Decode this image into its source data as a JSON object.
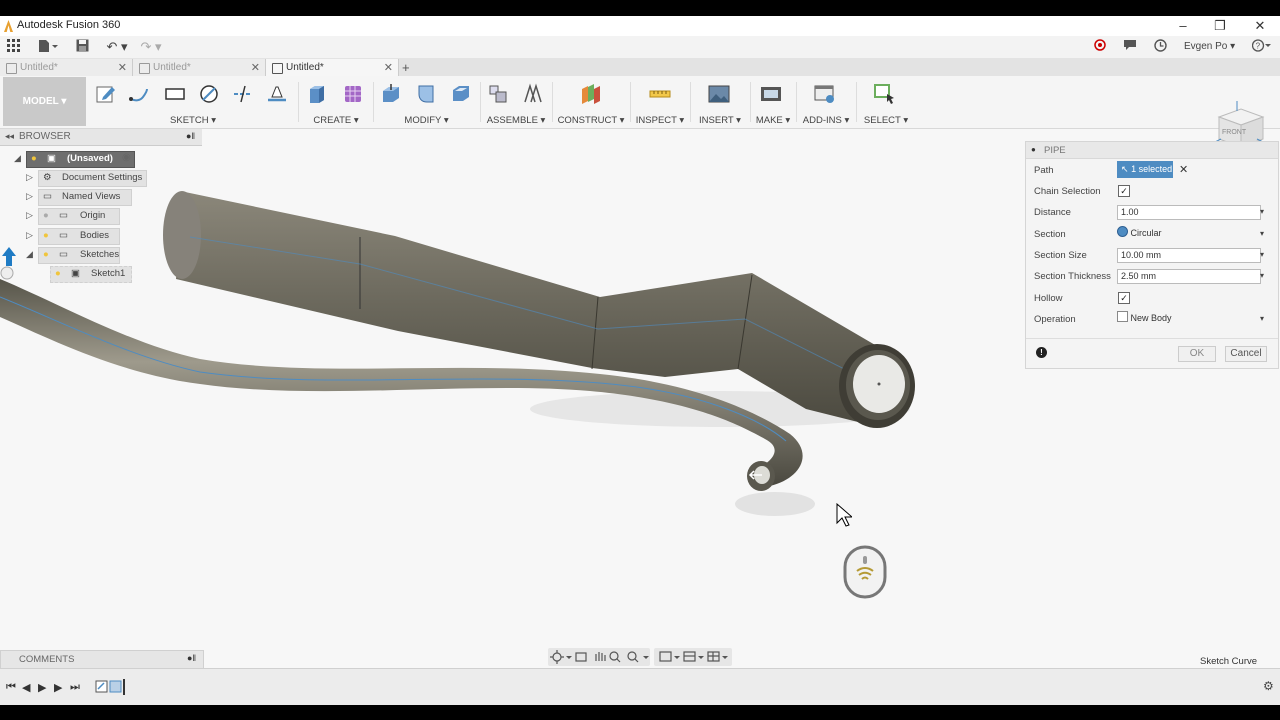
{
  "window": {
    "title": "Autodesk Fusion 360"
  },
  "appbar": {
    "user": "Evgen Po ▾"
  },
  "tabs": [
    {
      "label": "Untitled*",
      "active": false
    },
    {
      "label": "Untitled*",
      "active": false
    },
    {
      "label": "Untitled*",
      "active": true
    }
  ],
  "toolbar": {
    "workspace": "MODEL ▾",
    "groups": {
      "sketch": "SKETCH ▾",
      "create": "CREATE ▾",
      "modify": "MODIFY ▾",
      "assemble": "ASSEMBLE ▾",
      "construct": "CONSTRUCT ▾",
      "inspect": "INSPECT ▾",
      "insert": "INSERT ▾",
      "make": "MAKE ▾",
      "addins": "ADD-INS ▾",
      "select": "SELECT ▾"
    }
  },
  "browser": {
    "title": "BROWSER",
    "items": [
      {
        "label": "(Unsaved)"
      },
      {
        "label": "Document Settings"
      },
      {
        "label": "Named Views"
      },
      {
        "label": "Origin"
      },
      {
        "label": "Bodies"
      },
      {
        "label": "Sketches"
      },
      {
        "label": "Sketch1"
      }
    ]
  },
  "viewcube": {
    "face": "FRONT"
  },
  "dialog": {
    "title": "PIPE",
    "path_label": "Path",
    "path_value": "1 selected",
    "chain_label": "Chain Selection",
    "chain_checked": true,
    "distance_label": "Distance",
    "distance_value": "1.00",
    "section_label": "Section",
    "section_value": "Circular",
    "section_size_label": "Section Size",
    "section_size_value": "10.00 mm",
    "section_thickness_label": "Section Thickness",
    "section_thickness_value": "2.50 mm",
    "hollow_label": "Hollow",
    "hollow_checked": true,
    "operation_label": "Operation",
    "operation_value": "New Body",
    "ok_label": "OK",
    "cancel_label": "Cancel"
  },
  "comments": {
    "title": "COMMENTS"
  },
  "status": {
    "selection": "Sketch Curve"
  },
  "colors": {
    "accent": "#4e8cc2",
    "model_body": "#6d6a5e",
    "canvas": "#f7f7f7"
  }
}
